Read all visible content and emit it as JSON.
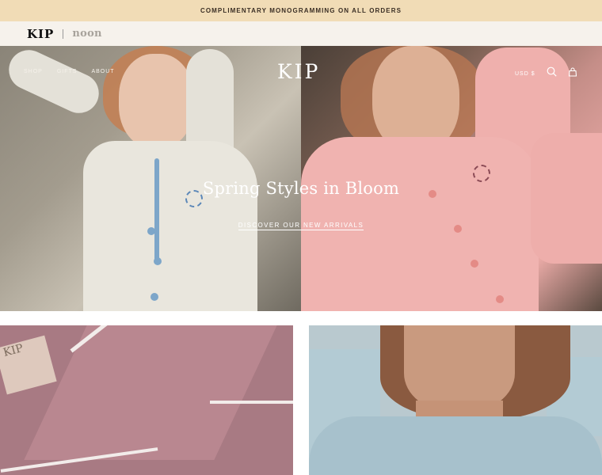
{
  "promo": {
    "text": "COMPLIMENTARY MONOGRAMMING ON ALL ORDERS"
  },
  "brand_switch": {
    "primary": "KIP",
    "secondary": "noon"
  },
  "nav": {
    "links": [
      "SHOP",
      "GIFTS",
      "ABOUT"
    ],
    "logo": "KIP",
    "currency": "USD $",
    "icons": [
      "search-icon",
      "bag-icon"
    ]
  },
  "hero": {
    "headline": "Spring Styles in Bloom",
    "cta": "DISCOVER OUR NEW ARRIVALS"
  },
  "tiles": {
    "left_label": "KIP"
  },
  "colors": {
    "promo_bg": "#f1dcb6",
    "brand_bar_bg": "#f6f2ec",
    "white_pj": "#e9e6dd",
    "pink_pj": "#f0b3b0",
    "blue_piping": "#7da6c9"
  }
}
